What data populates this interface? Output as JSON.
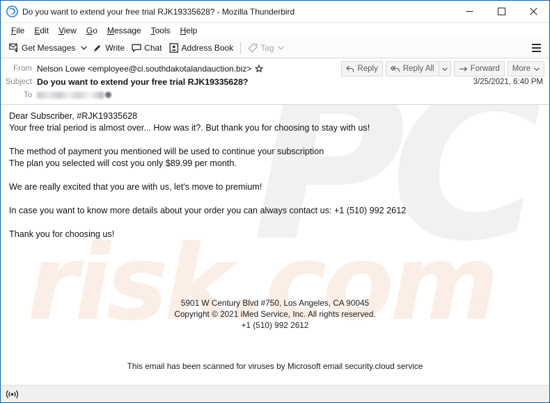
{
  "window": {
    "title": "Do you want to extend your free trial RJK19335628? - Mozilla Thunderbird",
    "app_icon": "thunderbird-icon",
    "controls": {
      "minimize": "minimize-icon",
      "maximize": "maximize-icon",
      "close": "close-icon"
    }
  },
  "menubar": {
    "items": [
      {
        "label": "File",
        "accel": "F"
      },
      {
        "label": "Edit",
        "accel": "E"
      },
      {
        "label": "View",
        "accel": "V"
      },
      {
        "label": "Go",
        "accel": "G"
      },
      {
        "label": "Message",
        "accel": "M"
      },
      {
        "label": "Tools",
        "accel": "T"
      },
      {
        "label": "Help",
        "accel": "H"
      }
    ]
  },
  "toolbar": {
    "get_messages": "Get Messages",
    "write": "Write",
    "chat": "Chat",
    "address_book": "Address Book",
    "tag": "Tag",
    "menu_icon": "hamburger-menu-icon"
  },
  "message_header": {
    "from_label": "From",
    "from_value": "Nelson Lowe <employee@ci.southdakotalandauction.biz>",
    "subject_label": "Subject",
    "subject_value": "Do you want to extend your free trial RJK19335628?",
    "to_label": "To",
    "to_value": "",
    "date": "3/25/2021, 6:40 PM",
    "actions": {
      "reply": "Reply",
      "reply_all": "Reply All",
      "forward": "Forward",
      "more": "More"
    }
  },
  "body": {
    "lines": [
      "Dear Subscriber, #RJK19335628",
      "Your free trial period is almost over... How was it?. But thank you for choosing to stay with us!",
      "",
      "The method of payment you mentioned will be used to continue your subscription",
      "The plan you selected will cost you only $89.99 per month.",
      "",
      "We are really excited that you are with us, let's move to premium!",
      "",
      "In case you want to know more details about your order you can always contact us: +1 (510) 992 2612",
      "",
      "Thank you for choosing us!"
    ],
    "footer": [
      "5901 W Century Blvd #750, Los Angeles, CA 90045",
      "Copyright © 2021 iMed Service, Inc. All rights reserved.",
      "+1 (510) 992 2612"
    ],
    "scan_note": "This email has been scanned for viruses by Microsoft email security.cloud service",
    "watermark_primary": "PC",
    "watermark_secondary": "risk.com"
  },
  "statusbar": {
    "icon": "broadcast-icon"
  },
  "colors": {
    "window_border": "#0b5ea8",
    "toolbar_bg": "#fbfbfb",
    "statusbar_bg": "#f0f0f0",
    "text": "#111111",
    "muted_label": "#8a8a8a",
    "watermark_gray": "#f0f1f3",
    "watermark_peach": "#fbeee6"
  }
}
